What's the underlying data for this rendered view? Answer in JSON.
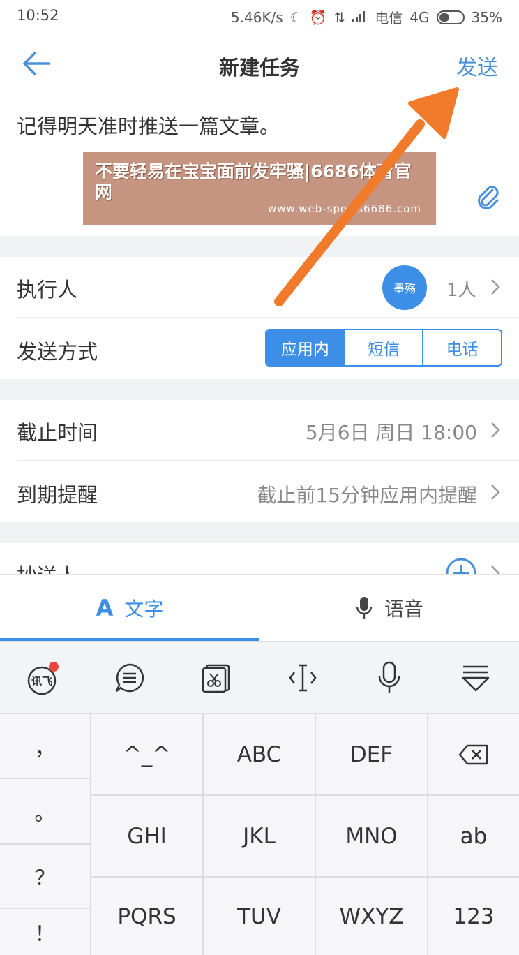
{
  "status_bar": {
    "time": "10:52",
    "speed": "5.46K/s",
    "carrier": "电信",
    "network": "4G",
    "battery": "35%"
  },
  "nav": {
    "title": "新建任务",
    "send_label": "发送"
  },
  "task": {
    "content": "记得明天准时推送一篇文章。"
  },
  "watermark": {
    "text": "不要轻易在宝宝面前发牢骚|6686体育官网",
    "url": "www.web-sports6686.com"
  },
  "form": {
    "assignee": {
      "label": "执行人",
      "avatar_text": "墨殇",
      "count": "1人"
    },
    "send_method": {
      "label": "发送方式",
      "options": [
        "应用内",
        "短信",
        "电话"
      ],
      "selected": "应用内"
    },
    "deadline": {
      "label": "截止时间",
      "value": "5月6日 周日 18:00"
    },
    "reminder": {
      "label": "到期提醒",
      "value": "截止前15分钟应用内提醒"
    },
    "cc": {
      "label": "抄送人"
    }
  },
  "input_tabs": {
    "text_icon": "A",
    "text_label": "文字",
    "voice_label": "语音"
  },
  "toolbar": {
    "logo_text": "讯飞",
    "icons": [
      "iflytek-logo-icon",
      "chat-bubble-icon",
      "clipboard-icon",
      "cursor-move-icon",
      "microphone-icon",
      "collapse-keyboard-icon"
    ]
  },
  "keyboard": {
    "punctuation": [
      "，",
      "。",
      "？",
      "！"
    ],
    "row1": [
      "^_^",
      "ABC",
      "DEF"
    ],
    "row2": [
      "GHI",
      "JKL",
      "MNO",
      "ab"
    ],
    "row3": [
      "PQRS",
      "TUV",
      "WXYZ",
      "123"
    ]
  },
  "colors": {
    "accent": "#3d8ee6",
    "arrow": "#f27a2b",
    "badge": "#e8463d"
  }
}
